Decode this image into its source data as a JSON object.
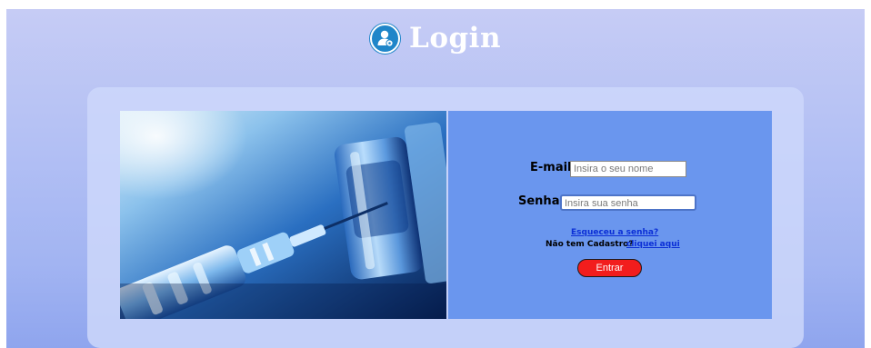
{
  "header": {
    "title": "Login",
    "icon": "user-admin-icon"
  },
  "form": {
    "email_label": "E-mail:",
    "email_placeholder": "Insira o seu nome",
    "password_label": "Senha:",
    "password_placeholder": "Insira sua senha",
    "forgot_link": "Esqueceu a senha?",
    "register_prompt": "Não tem Cadastro?",
    "register_link": "cliquei aqui",
    "submit_label": "Entrar"
  },
  "colors": {
    "panel": "#6a96ee",
    "button": "#f21d1d",
    "link": "#0b2fd6",
    "icon": "#1f86c9"
  }
}
